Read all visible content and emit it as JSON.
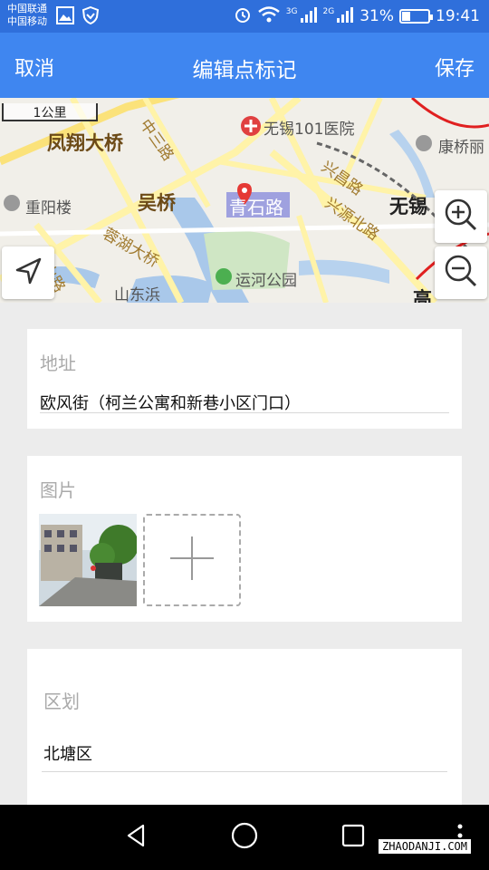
{
  "status": {
    "carrier1": "中国联通",
    "carrier2": "中国移动",
    "net1": "3G",
    "net2": "2G",
    "battery_text": "31%",
    "battery_level": 0.31,
    "time": "19:41"
  },
  "header": {
    "left_label": "取消",
    "title": "编辑点标记",
    "right_label": "保存"
  },
  "map": {
    "scale_label": "1公里",
    "labels": {
      "fengxiang": "凤翔大桥",
      "zhongsan": "中三路",
      "hospital": "无锡101医院",
      "xingchang": "兴昌路",
      "kangqiao": "康桥丽",
      "chongyang": "重阳楼",
      "wuqiao": "吴桥",
      "qingshi": "青石路",
      "xingyuan": "兴源北路",
      "wuxi": "无锡",
      "penghu": "蓉湖大桥",
      "yunhe": "运河公园",
      "shandong": "山东浜",
      "shanlu": "山路",
      "gao": "高"
    }
  },
  "form": {
    "address_label": "地址",
    "address_value": "欧风街（柯兰公寓和新巷小区门口）",
    "image_label": "图片",
    "district_label": "区划",
    "district_value": "北塘区"
  },
  "nav": {
    "watermark": "ZHAODANJI.COM"
  }
}
